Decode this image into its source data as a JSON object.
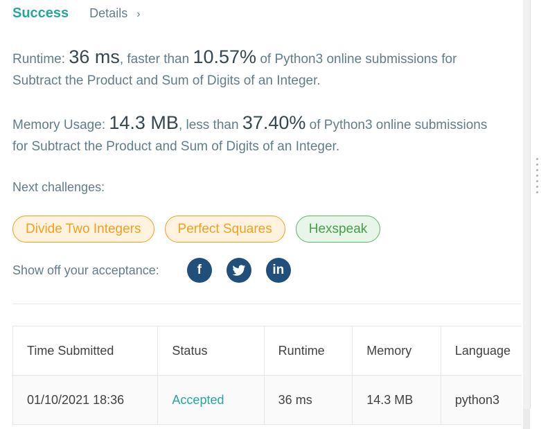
{
  "header": {
    "status": "Success",
    "details_label": "Details",
    "details_chevron": "›"
  },
  "runtime": {
    "label": "Runtime: ",
    "value": "36 ms",
    "mid": ", faster than ",
    "percent": "10.57%",
    "tail1": " of Python3 online submissions for",
    "tail2": "Subtract the Product and Sum of Digits of an Integer."
  },
  "memory": {
    "label": "Memory Usage: ",
    "value": "14.3 MB",
    "mid": ", less than ",
    "percent": "37.40%",
    "tail1": " of Python3 online submissions",
    "tail2": "for Subtract the Product and Sum of Digits of an Integer."
  },
  "next": {
    "label": "Next challenges:",
    "challenges": [
      {
        "name": "Divide Two Integers",
        "difficulty_color": "#f0a020"
      },
      {
        "name": "Perfect Squares",
        "difficulty_color": "#f0a020"
      },
      {
        "name": "Hexspeak",
        "difficulty_color": "#43a047"
      }
    ]
  },
  "share": {
    "label": "Show off your acceptance:",
    "icons": [
      {
        "name": "facebook-icon",
        "glyph": "f"
      },
      {
        "name": "twitter-icon",
        "glyph": "t"
      },
      {
        "name": "linkedin-icon",
        "glyph": "in"
      }
    ]
  },
  "table": {
    "headers": [
      "Time Submitted",
      "Status",
      "Runtime",
      "Memory",
      "Language"
    ],
    "rows": [
      [
        "01/10/2021 18:36",
        "Accepted",
        "36 ms",
        "14.3 MB",
        "python3"
      ]
    ]
  },
  "colors": {
    "accent": "#26a69a",
    "medium": "#f0a020",
    "easy": "#43a047",
    "social": "#1f4f7a"
  }
}
